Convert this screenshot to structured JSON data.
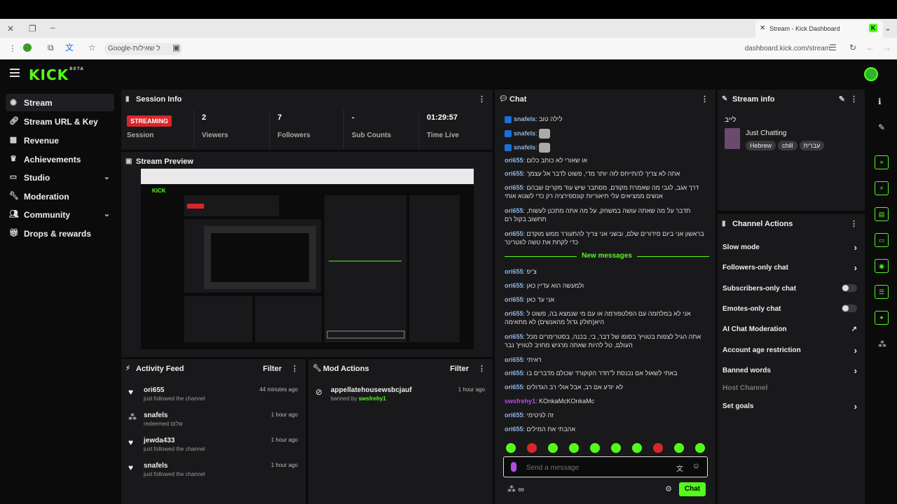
{
  "browser": {
    "tab_title": "Stream - Kick Dashboard",
    "url": "dashboard.kick.com/stream",
    "omnibox_text": "Google-ל שאילות"
  },
  "header": {
    "logo": "KICK",
    "logo_badge": "BETA"
  },
  "sidebar": {
    "items": [
      {
        "label": "Stream",
        "icon": "broadcast-icon"
      },
      {
        "label": "Stream URL & Key",
        "icon": "link-icon"
      },
      {
        "label": "Revenue",
        "icon": "bar-chart-icon"
      },
      {
        "label": "Achievements",
        "icon": "trophy-icon"
      },
      {
        "label": "Studio",
        "icon": "monitor-icon"
      },
      {
        "label": "Moderation",
        "icon": "wrench-icon"
      },
      {
        "label": "Community",
        "icon": "people-icon"
      },
      {
        "label": "Drops & rewards",
        "icon": "gift-icon"
      }
    ]
  },
  "session": {
    "title": "Session Info",
    "status": "STREAMING",
    "status_label": "Session",
    "viewers": "2",
    "viewers_label": "Viewers",
    "followers": "7",
    "followers_label": "Followers",
    "subs": "-",
    "subs_label": "Sub Counts",
    "time": "01:29:57",
    "time_label": "Time Live"
  },
  "preview": {
    "title": "Stream Preview"
  },
  "activity": {
    "title": "Activity Feed",
    "filter": "Filter",
    "items": [
      {
        "name": "ori655",
        "desc": "just followed the channel",
        "time": "44 minutes ago"
      },
      {
        "name": "snafels",
        "desc": "redeemed שלום",
        "time": "1 hour ago"
      },
      {
        "name": "jewda433",
        "desc": "just followed the channel",
        "time": "1 hour ago"
      },
      {
        "name": "snafels",
        "desc": "just followed the channel",
        "time": "1 hour ago"
      }
    ]
  },
  "mod_actions": {
    "title": "Mod Actions",
    "filter": "Filter",
    "items": [
      {
        "name": "appellatehousewsbcjauf",
        "desc_prefix": "banned by",
        "by": "swsfrehy1",
        "time": "1 hour ago"
      }
    ]
  },
  "chat": {
    "title": "Chat",
    "new_messages": "New messages",
    "messages": [
      {
        "user": "snafels",
        "text": "לילה טוב"
      },
      {
        "user": "snafels",
        "text": ""
      },
      {
        "user": "snafels",
        "text": ""
      },
      {
        "user": "ori655",
        "text": "או שאורי לא כותב כלום"
      },
      {
        "user": "ori655",
        "text": "אתה לא צריך להתייחס לזה יותר מדי, פשוט לדבר אל עצמך"
      },
      {
        "user": "ori655",
        "text": "דרך אגב, לגבי מה שאמרת מקודם, מסתבר שיש עוד מקרים שבהם אנשים ממציאים עלי תיאוריות קונספירציה רק כדי לשנוא אותי"
      },
      {
        "user": "ori655",
        "text": "תדבר על מה שאתה עושה במשחק, על מה אתה מתכנן לעשות, תחשוב בקול רם"
      },
      {
        "user": "ori655",
        "text": "בראשון אני ביום סידורים שלם, ובשני אני צריך להתעורר ממש מוקדם כדי לקחת את טשה לווטרינר"
      },
      {
        "user": "ori655",
        "text": "צ'יפ"
      },
      {
        "user": "ori655",
        "text": "ולמעשה הוא עדיין כאן"
      },
      {
        "user": "ori655",
        "text": "אני עד כאן"
      },
      {
        "user": "ori655",
        "text": "אני לא במלחמה עם הפלטפורמה או עם מי שנמצא בה, פשוט ל היא(חולק גדול מהאנשים) לא מתאימה"
      },
      {
        "user": "ori655",
        "text": "אתה הגיל לצפות בטוויץ' בסופו של דבר, בי, בכנה, בסטרימרים מכל העולם, טל להיות שאתה מרגיש מחויב לטוויץ' נבר"
      },
      {
        "user": "ori655",
        "text": "ראיתי"
      },
      {
        "user": "ori655",
        "text": "באתי לשאול אם נכנסת ל\"חדר הקוקורד שכולם מדברים בו"
      },
      {
        "user": "ori655",
        "text": "לא יודע אם רב, אבל אולי רב הגדולים"
      },
      {
        "user": "swsfrehy1",
        "text": "KOnkaMcKOnkaMc"
      },
      {
        "user": "ori655",
        "text": "זה לגיטימי"
      },
      {
        "user": "ori655",
        "text": "אהבתי את המילים"
      }
    ],
    "input_placeholder": "Send a message",
    "send_label": "Chat",
    "footer_icons": "∞"
  },
  "stream_info": {
    "title": "Stream info",
    "stream_title": "לייב",
    "category": "Just Chatting",
    "tags": [
      "Hebrew",
      "chill",
      "עברית"
    ]
  },
  "channel_actions": {
    "title": "Channel Actions",
    "items": [
      {
        "label": "Slow mode",
        "control": "arrow"
      },
      {
        "label": "Followers-only chat",
        "control": "arrow"
      },
      {
        "label": "Subscribers-only chat",
        "control": "toggle"
      },
      {
        "label": "Emotes-only chat",
        "control": "toggle"
      },
      {
        "label": "AI Chat Moderation",
        "control": "external"
      },
      {
        "label": "Account age restriction",
        "control": "arrow"
      },
      {
        "label": "Banned words",
        "control": "arrow"
      },
      {
        "label": "Host Channel",
        "control": "none"
      },
      {
        "label": "Set goals",
        "control": "arrow"
      }
    ]
  },
  "colors": {
    "accent": "#53fc18",
    "panel": "#19191b",
    "background": "#0b0b0c",
    "streaming": "#d9262b"
  }
}
